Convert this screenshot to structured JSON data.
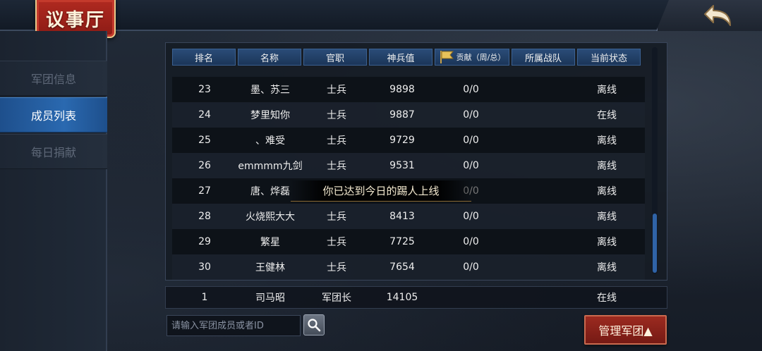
{
  "header": {
    "title": "议事厅",
    "accent_color": "#b02a20"
  },
  "sidebar": {
    "items": [
      {
        "label": "军团信息"
      },
      {
        "label": "成员列表"
      },
      {
        "label": "每日捐献"
      }
    ],
    "active_index": 1,
    "active_color": "#2a69b0"
  },
  "table": {
    "columns": [
      "排名",
      "名称",
      "官职",
      "神兵值",
      "贡献（周/总）",
      "所属战队",
      "当前状态"
    ],
    "rows": [
      {
        "rank": "23",
        "name": "墨、苏三",
        "title": "士兵",
        "power": "9898",
        "contrib": "0/0",
        "team": "",
        "status": "离线"
      },
      {
        "rank": "24",
        "name": "梦里知你",
        "title": "士兵",
        "power": "9887",
        "contrib": "0/0",
        "team": "",
        "status": "在线"
      },
      {
        "rank": "25",
        "name": "、难受",
        "title": "士兵",
        "power": "9729",
        "contrib": "0/0",
        "team": "",
        "status": "离线"
      },
      {
        "rank": "26",
        "name": "emmmm九剑",
        "title": "士兵",
        "power": "9531",
        "contrib": "0/0",
        "team": "",
        "status": "离线"
      },
      {
        "rank": "27",
        "name": "唐、烨磊",
        "title": "",
        "power": "",
        "contrib": "0/0",
        "team": "",
        "status": "离线"
      },
      {
        "rank": "28",
        "name": "火烧熙大大",
        "title": "士兵",
        "power": "8413",
        "contrib": "0/0",
        "team": "",
        "status": "离线"
      },
      {
        "rank": "29",
        "name": "繁星",
        "title": "士兵",
        "power": "7725",
        "contrib": "0/0",
        "team": "",
        "status": "离线"
      },
      {
        "rank": "30",
        "name": "王健林",
        "title": "士兵",
        "power": "7654",
        "contrib": "0/0",
        "team": "",
        "status": "离线"
      }
    ],
    "self": {
      "rank": "1",
      "name": "司马昭",
      "title": "军团长",
      "power": "14105",
      "contrib": "",
      "team": "",
      "status": "在线"
    }
  },
  "toast": {
    "text": "你已达到今日的踢人上线"
  },
  "search": {
    "placeholder": "请输入军团成员或者ID"
  },
  "manage_button": {
    "label": "管理军团▲"
  },
  "icons": {
    "back": "back-arrow-icon",
    "search": "search-icon",
    "flag": "flag-icon"
  }
}
